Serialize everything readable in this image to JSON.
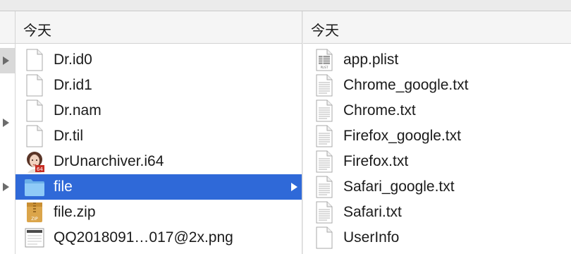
{
  "middle_column": {
    "header": "今天",
    "items": [
      {
        "label": "Dr.id0",
        "icon": "blank-document-icon"
      },
      {
        "label": "Dr.id1",
        "icon": "blank-document-icon"
      },
      {
        "label": "Dr.nam",
        "icon": "blank-document-icon"
      },
      {
        "label": "Dr.til",
        "icon": "blank-document-icon"
      },
      {
        "label": "DrUnarchiver.i64",
        "icon": "app-portrait-icon"
      },
      {
        "label": "file",
        "icon": "folder-icon",
        "selected": true
      },
      {
        "label": "file.zip",
        "icon": "zip-archive-icon"
      },
      {
        "label": "QQ2018091…017@2x.png",
        "icon": "image-file-icon"
      }
    ]
  },
  "right_column": {
    "header": "今天",
    "items": [
      {
        "label": "app.plist",
        "icon": "plist-file-icon"
      },
      {
        "label": "Chrome_google.txt",
        "icon": "text-document-icon"
      },
      {
        "label": "Chrome.txt",
        "icon": "text-document-icon"
      },
      {
        "label": "Firefox_google.txt",
        "icon": "text-document-icon"
      },
      {
        "label": "Firefox.txt",
        "icon": "text-document-icon"
      },
      {
        "label": "Safari_google.txt",
        "icon": "text-document-icon"
      },
      {
        "label": "Safari.txt",
        "icon": "text-document-icon"
      },
      {
        "label": "UserInfo",
        "icon": "blank-document-icon"
      }
    ]
  },
  "colors": {
    "selection": "#2f69d8",
    "folder": "#78bdf3",
    "zip": "#d9a441",
    "header_bg": "#f5f5f5"
  }
}
